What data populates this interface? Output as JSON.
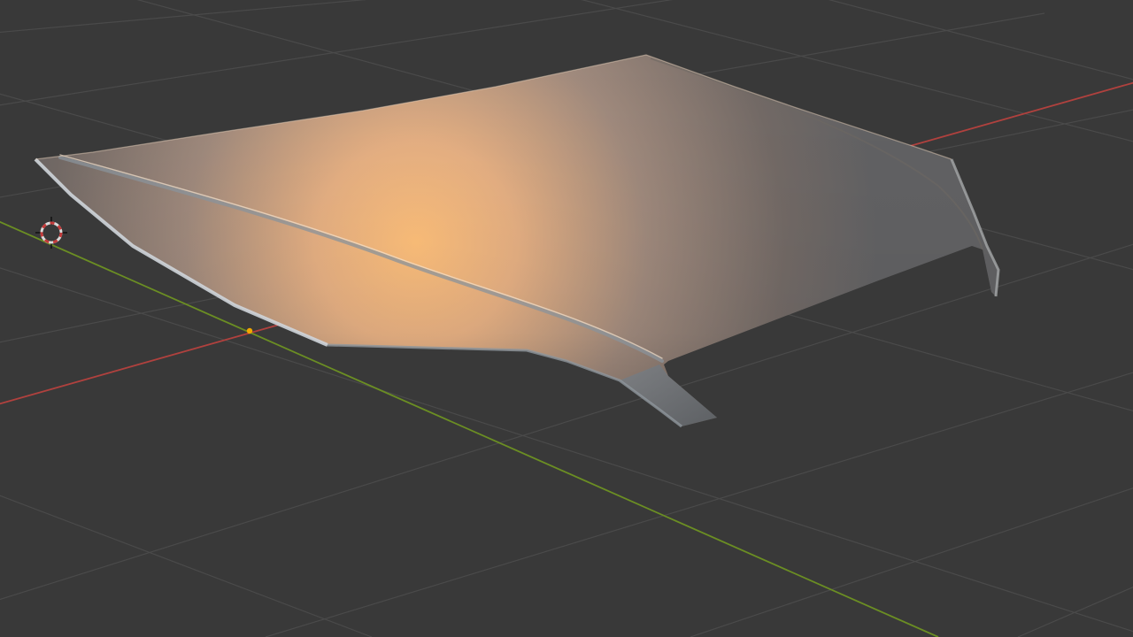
{
  "app": {
    "name": "",
    "view": ""
  },
  "viewport": {
    "background_color": "#393939",
    "grid_line_color": "#4a4a4a",
    "x_axis_color": "#b0413e",
    "y_axis_color": "#6b8e23",
    "show_grid": true,
    "show_floor_axes": true,
    "shading_mode": "solid",
    "lighting": "studio"
  },
  "scene": {
    "objects": [
      {
        "name": "",
        "type": "mesh",
        "description_shape": "car-hood",
        "base_color": "#c7b09a",
        "highlight_color": "#ffc07a",
        "shadow_color": "#5f6467",
        "edge_color": "#9aa3aa"
      }
    ],
    "cursor_3d": {
      "icon": "3d-cursor-icon",
      "ring_colors": [
        "#d9d9d9",
        "#c33a3a"
      ]
    },
    "origin_marker": {
      "icon": "origin-dot-icon",
      "color": "#f2a600"
    }
  }
}
